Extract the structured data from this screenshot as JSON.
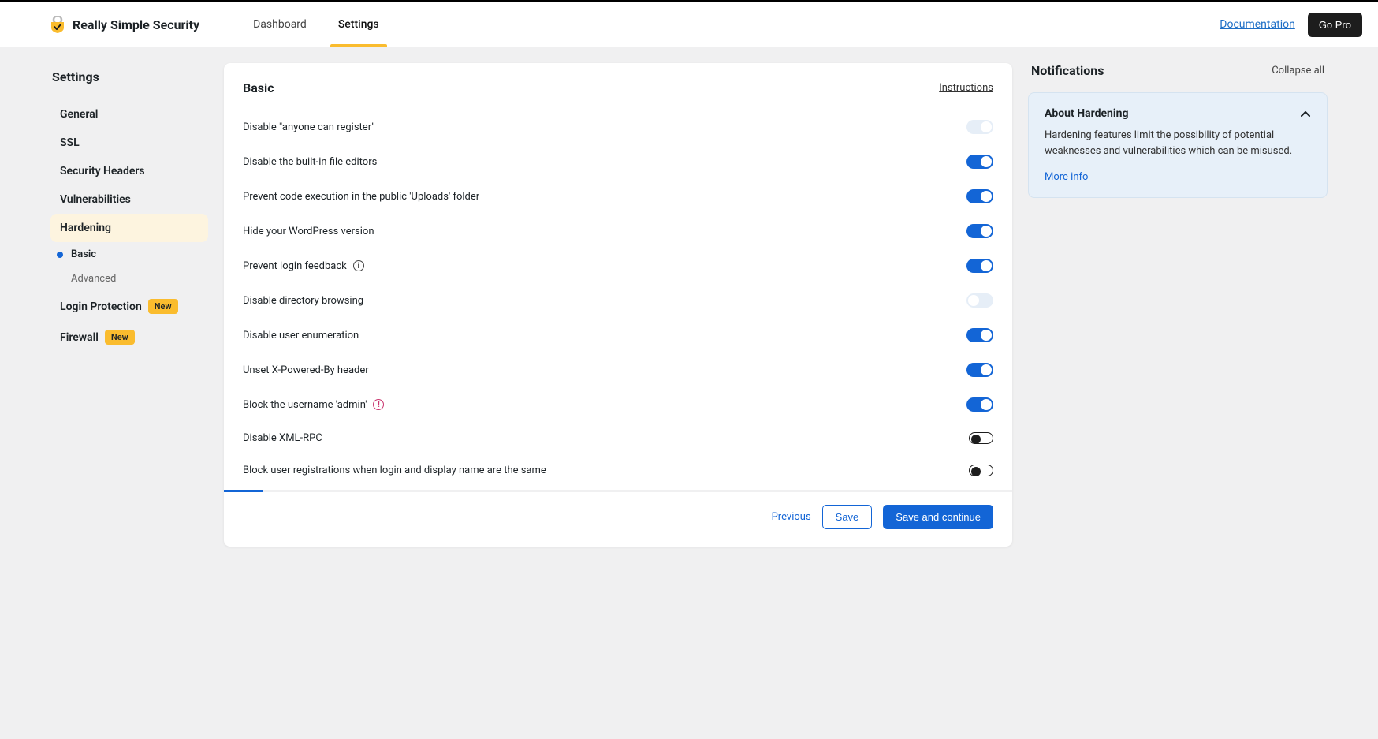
{
  "brand": "Really Simple Security",
  "header": {
    "tabs": [
      "Dashboard",
      "Settings"
    ],
    "active_tab": 1,
    "documentation": "Documentation",
    "gopro": "Go Pro"
  },
  "sidebar": {
    "title": "Settings",
    "items": [
      {
        "label": "General"
      },
      {
        "label": "SSL"
      },
      {
        "label": "Security Headers"
      },
      {
        "label": "Vulnerabilities"
      },
      {
        "label": "Hardening",
        "active": true,
        "subs": [
          {
            "label": "Basic",
            "active": true
          },
          {
            "label": "Advanced"
          }
        ]
      },
      {
        "label": "Login Protection",
        "badge": "New"
      },
      {
        "label": "Firewall",
        "badge": "New"
      }
    ]
  },
  "main": {
    "title": "Basic",
    "instructions": "Instructions",
    "settings": [
      {
        "label": "Disable \"anyone can register\"",
        "state": "disabled"
      },
      {
        "label": "Disable the built-in file editors",
        "state": "on"
      },
      {
        "label": "Prevent code execution in the public 'Uploads' folder",
        "state": "on"
      },
      {
        "label": "Hide your WordPress version",
        "state": "on"
      },
      {
        "label": "Prevent login feedback",
        "state": "on",
        "info": true
      },
      {
        "label": "Disable directory browsing",
        "state": "disabled-off"
      },
      {
        "label": "Disable user enumeration",
        "state": "on"
      },
      {
        "label": "Unset X-Powered-By header",
        "state": "on"
      },
      {
        "label": "Block the username 'admin'",
        "state": "on",
        "warn": true
      },
      {
        "label": "Disable XML-RPC",
        "state": "off"
      },
      {
        "label": "Block user registrations when login and display name are the same",
        "state": "off"
      }
    ],
    "progress_percent": 5,
    "footer": {
      "previous": "Previous",
      "save": "Save",
      "continue": "Save and continue"
    }
  },
  "notifications": {
    "title": "Notifications",
    "collapse_all": "Collapse all",
    "card": {
      "title": "About Hardening",
      "body": "Hardening features limit the possibility of potential weaknesses and vulnerabilities which can be misused.",
      "more_info": "More info"
    }
  }
}
